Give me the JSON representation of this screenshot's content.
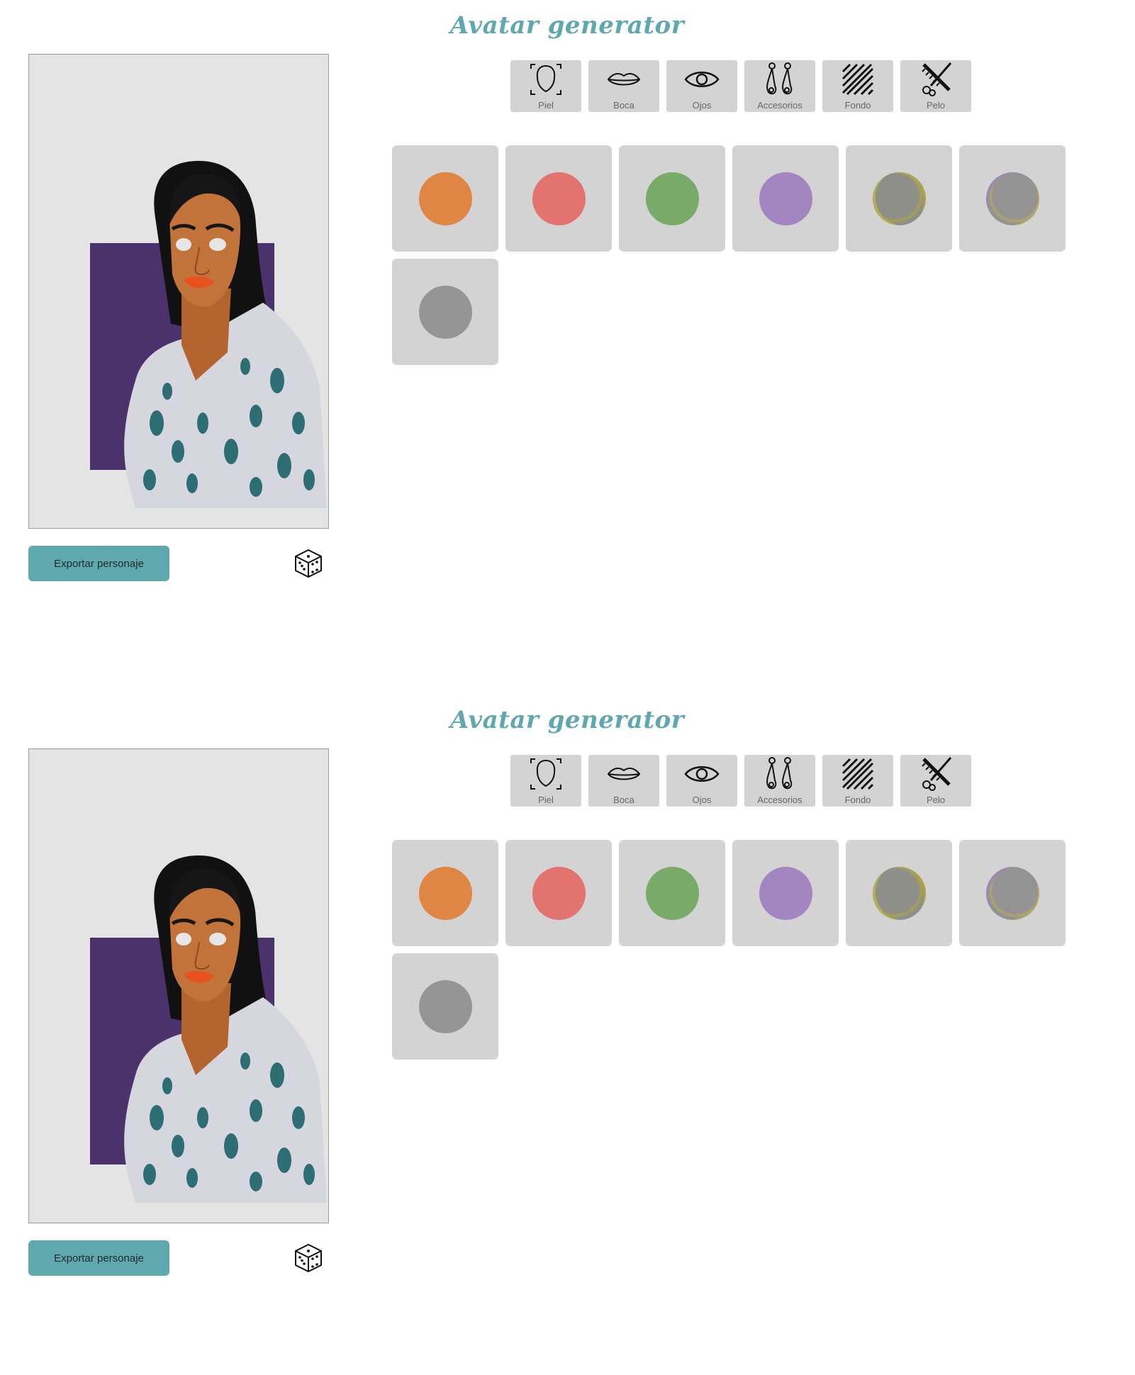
{
  "app": {
    "title": "Avatar generator"
  },
  "tabs": [
    {
      "label": "Piel",
      "icon": "face-outline-icon"
    },
    {
      "label": "Boca",
      "icon": "lips-icon"
    },
    {
      "label": "Ojos",
      "icon": "eye-icon"
    },
    {
      "label": "Accesorios",
      "icon": "earrings-icon"
    },
    {
      "label": "Fondo",
      "icon": "diagonal-stripes-icon"
    },
    {
      "label": "Pelo",
      "icon": "scissors-comb-icon"
    }
  ],
  "swatches": [
    {
      "color": "#df8644",
      "kind": "solid"
    },
    {
      "color": "#e2736e",
      "kind": "solid"
    },
    {
      "color": "#78aa68",
      "kind": "solid"
    },
    {
      "color": "#a385c2",
      "kind": "solid"
    },
    {
      "color": "#8f8f8a",
      "kind": "hair-a"
    },
    {
      "color": "#939393",
      "kind": "hair-b"
    },
    {
      "color": "#959595",
      "kind": "solid"
    }
  ],
  "actions": {
    "export_label": "Exportar personaje",
    "randomize_icon": "dice-icon"
  },
  "colors": {
    "accent": "#5fa8ae",
    "canvas_bg": "#e4e4e4",
    "avatar_background_block": "#4b326d",
    "tile_bg": "#d3d3d3"
  }
}
